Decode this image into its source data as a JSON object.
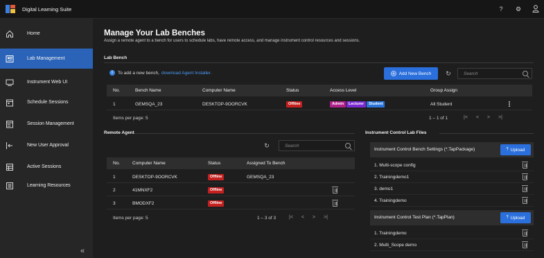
{
  "app": {
    "title": "Digital Learning Suite"
  },
  "topbar_icons": [
    "help-icon",
    "gear-icon",
    "user-icon"
  ],
  "sidebar": {
    "items": [
      {
        "label": "Home",
        "icon": "home-icon",
        "active": false
      },
      {
        "label": "Lab Management",
        "icon": "lab-icon",
        "active": true
      },
      {
        "label": "Instrument Web UI",
        "icon": "monitor-icon",
        "active": false
      },
      {
        "label": "Schedule Sessions",
        "icon": "calendar-icon",
        "active": false
      },
      {
        "label": "Session Management",
        "icon": "calendar-grid-icon",
        "active": false
      },
      {
        "label": "New User Approval",
        "icon": "user-approval-icon",
        "active": false
      },
      {
        "label": "Active Sessions",
        "icon": "table-icon",
        "active": false
      },
      {
        "label": "Learning Resources",
        "icon": "book-icon",
        "active": false
      }
    ],
    "collapse": "«"
  },
  "page": {
    "title": "Manage Your Lab Benches",
    "subtitle": "Assign a remote agent to a bench for users to schedule labs, have remote access, and manage instrument control resources and sessions."
  },
  "lab_bench": {
    "section": "Lab Bench",
    "info_text": "To add a new bench,",
    "info_link": "download Agent Installer.",
    "add_button": "Add New Bench",
    "search_placeholder": "Search",
    "columns": [
      "No.",
      "Bench Name",
      "Computer Name",
      "Status",
      "Access Level",
      "Group Assign"
    ],
    "rows": [
      {
        "no": "1",
        "bench": "GEMSQA_23",
        "computer": "DESKTOP-9OORCVK",
        "status": "Offline",
        "access": [
          "Admin",
          "Lecturer",
          "Student"
        ],
        "group": "All Student"
      }
    ],
    "items_per_page": "Items per page:  5",
    "range": "1 – 1 of 1"
  },
  "remote_agent": {
    "section": "Remote Agent",
    "search_placeholder": "Search",
    "columns": [
      "No.",
      "Computer Name",
      "Status",
      "Assigned To Bench"
    ],
    "rows": [
      {
        "no": "1",
        "computer": "DESKTOP-9OORCVK",
        "status": "Offline",
        "bench": "GEMSQA_23",
        "deletable": false
      },
      {
        "no": "2",
        "computer": "41MNXF2",
        "status": "Offline",
        "bench": "",
        "deletable": true
      },
      {
        "no": "3",
        "computer": "BMODXF2",
        "status": "Offline",
        "bench": "",
        "deletable": true
      }
    ],
    "items_per_page": "Items per page:  5",
    "range": "1 – 3 of 3"
  },
  "files": {
    "section": "Instrument Control Lab Files",
    "bench_settings": {
      "title": "Instrument Control Bench Settings (*.TapPackage)",
      "upload": "Upload",
      "items": [
        "1. Multi-scope config",
        "2. Trainingdemo1",
        "3. demo1",
        "4. Trainingdemo"
      ]
    },
    "test_plan": {
      "title": "Instrument Control Test Plan (*.TapPlan)",
      "upload": "Upload",
      "items": [
        "1. Trainingdemo",
        "2. Multi_Scope demo"
      ]
    }
  },
  "colors": {
    "accent": "#2a6fdb",
    "offline": "#c32020",
    "admin": "#b0208a",
    "lecturer": "#7a2ad1",
    "student": "#2b74d8"
  }
}
